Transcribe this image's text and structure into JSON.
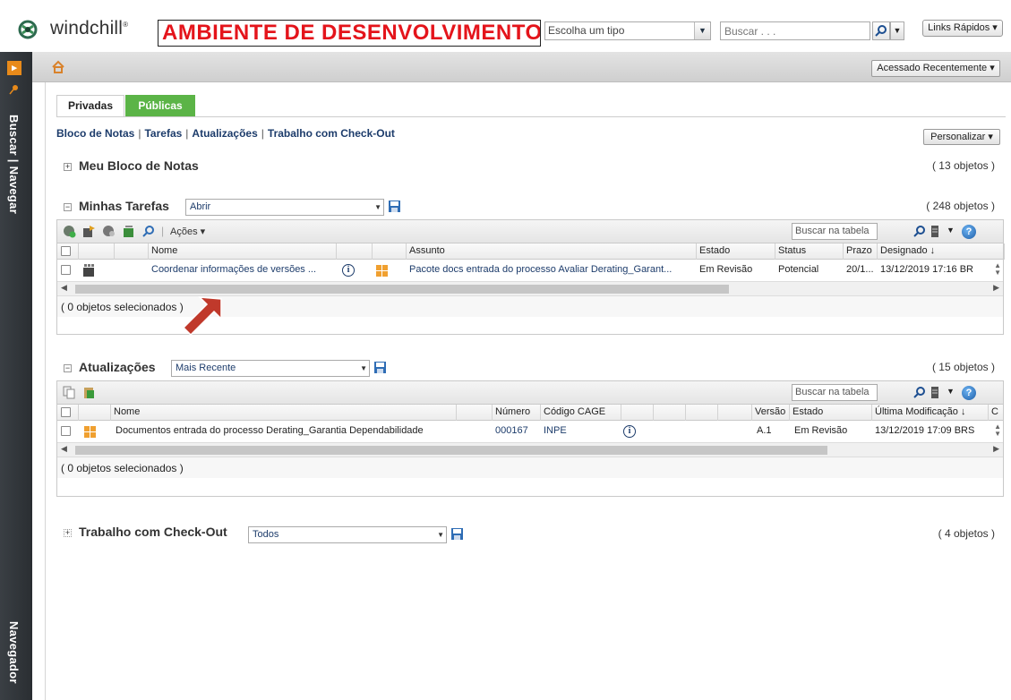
{
  "header": {
    "logo_text": "windchill",
    "logo_mark": "®",
    "env_banner": "AMBIENTE DE DESENVOLVIMENTO",
    "type_select": "Escolha um tipo",
    "search_placeholder": "Buscar . . .",
    "quick_links": "Links Rápidos ▾"
  },
  "rail": {
    "search_nav": "Buscar | Navegar",
    "navigator": "Navegador"
  },
  "crumb": {
    "recent": "Acessado Recentemente ▾"
  },
  "tabs": {
    "private": "Privadas",
    "public": "Públicas"
  },
  "subnav": {
    "notebook": "Bloco de Notas",
    "tasks": "Tarefas",
    "updates": "Atualizações",
    "checkout": "Trabalho com Check-Out"
  },
  "customize": "Personalizar ▾",
  "notebook": {
    "title": "Meu Bloco de Notas",
    "count": "( 13 objetos )"
  },
  "tasks": {
    "title": "Minhas Tarefas",
    "view": "Abrir",
    "count": "( 248 objetos )",
    "actions": "Ações ▾",
    "search": "Buscar na tabela",
    "columns": {
      "name": "Nome",
      "subject": "Assunto",
      "state": "Estado",
      "status": "Status",
      "due": "Prazo",
      "assigned": "Designado ↓"
    },
    "row": {
      "name": "Coordenar informações de versões ...",
      "subject": "Pacote docs entrada do processo Avaliar Derating_Garant...",
      "state": "Em Revisão",
      "status": "Potencial",
      "due": "20/1...",
      "assigned": "13/12/2019 17:16 BR"
    },
    "footer": "( 0 objetos selecionados )"
  },
  "updates": {
    "title": "Atualizações",
    "view": "Mais Recente",
    "count": "( 15 objetos )",
    "search": "Buscar na tabela",
    "columns": {
      "name": "Nome",
      "number": "Número",
      "cage": "Código CAGE",
      "version": "Versão",
      "state": "Estado",
      "modified": "Última Modificação ↓",
      "extra": "C"
    },
    "row": {
      "name": "Documentos entrada do processo Derating_Garantia Dependabilidade",
      "number": "000167",
      "cage": "INPE",
      "version": "A.1",
      "state": "Em Revisão",
      "modified": "13/12/2019 17:09 BRS"
    },
    "footer": "( 0 objetos selecionados )"
  },
  "checkout": {
    "title": "Trabalho com Check-Out",
    "view": "Todos",
    "count": "( 4 objetos )"
  },
  "colors": {
    "accent_green": "#5bb447",
    "banner_red": "#e4141b",
    "link_blue": "#1d3c6b",
    "rail_dark": "#2e3338",
    "arrow_red": "#c0392b"
  }
}
